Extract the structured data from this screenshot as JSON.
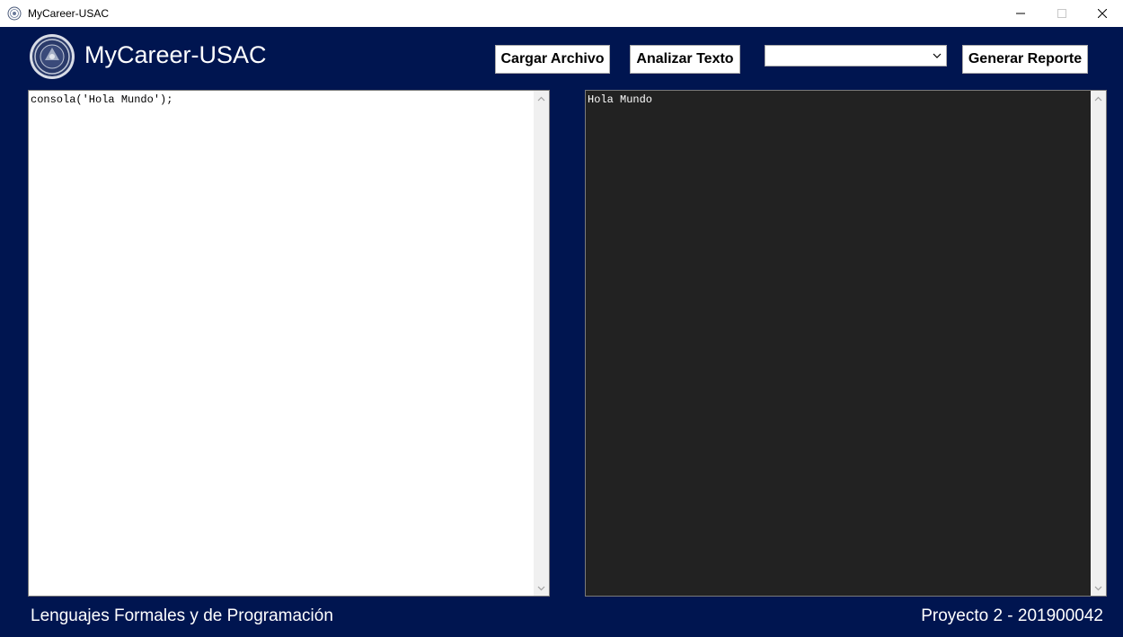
{
  "window": {
    "title": "MyCareer-USAC"
  },
  "header": {
    "app_title": "MyCareer-USAC",
    "logo_icon": "university-seal-icon"
  },
  "toolbar": {
    "cargar_label": "Cargar Archivo",
    "analizar_label": "Analizar Texto",
    "report_select_value": "",
    "generar_label": "Generar Reporte"
  },
  "editor": {
    "input_text": "consola('Hola Mundo');"
  },
  "console": {
    "output_text": "Hola Mundo"
  },
  "footer": {
    "course": "Lenguajes Formales y de Programación",
    "project": "Proyecto 2 - 201900042"
  },
  "colors": {
    "window_bg": "#001550",
    "console_bg": "#222222",
    "text_light": "#ffffff"
  }
}
